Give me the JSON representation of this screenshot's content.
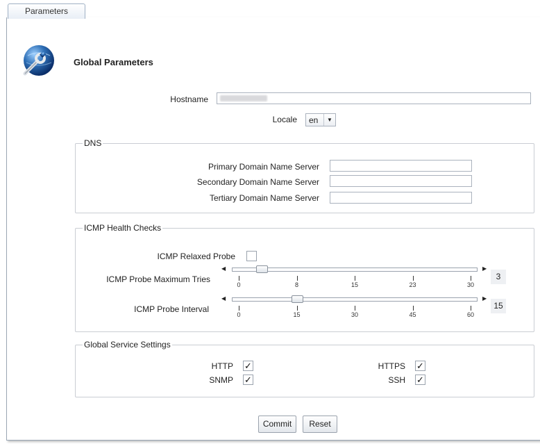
{
  "tab": {
    "label": "Parameters"
  },
  "header": {
    "title": "Global Parameters",
    "icon": "wrench-globe-icon"
  },
  "general": {
    "hostname_label": "Hostname",
    "hostname_value": "",
    "locale_label": "Locale",
    "locale_value": "en"
  },
  "dns": {
    "legend": "DNS",
    "primary_label": "Primary Domain Name Server",
    "primary_value": "",
    "secondary_label": "Secondary Domain Name Server",
    "secondary_value": "",
    "tertiary_label": "Tertiary Domain Name Server",
    "tertiary_value": ""
  },
  "icmp": {
    "legend": "ICMP Health Checks",
    "relaxed_label": "ICMP Relaxed Probe",
    "relaxed_checked": false,
    "max_tries": {
      "label": "ICMP Probe Maximum Tries",
      "value": "3",
      "ticks": [
        "0",
        "8",
        "15",
        "23",
        "30"
      ],
      "min": 0,
      "max": 30
    },
    "interval": {
      "label": "ICMP Probe Interval",
      "value": "15",
      "ticks": [
        "0",
        "15",
        "30",
        "45",
        "60"
      ],
      "min": 0,
      "max": 60
    }
  },
  "services": {
    "legend": "Global Service Settings",
    "http_label": "HTTP",
    "http_checked": true,
    "https_label": "HTTPS",
    "https_checked": true,
    "snmp_label": "SNMP",
    "snmp_checked": true,
    "ssh_label": "SSH",
    "ssh_checked": true,
    "check_glyph": "✓"
  },
  "actions": {
    "commit_label": "Commit",
    "reset_label": "Reset"
  },
  "colors": {
    "accent": "#2e6fb6",
    "tab_bg": "#dfe8f3"
  }
}
